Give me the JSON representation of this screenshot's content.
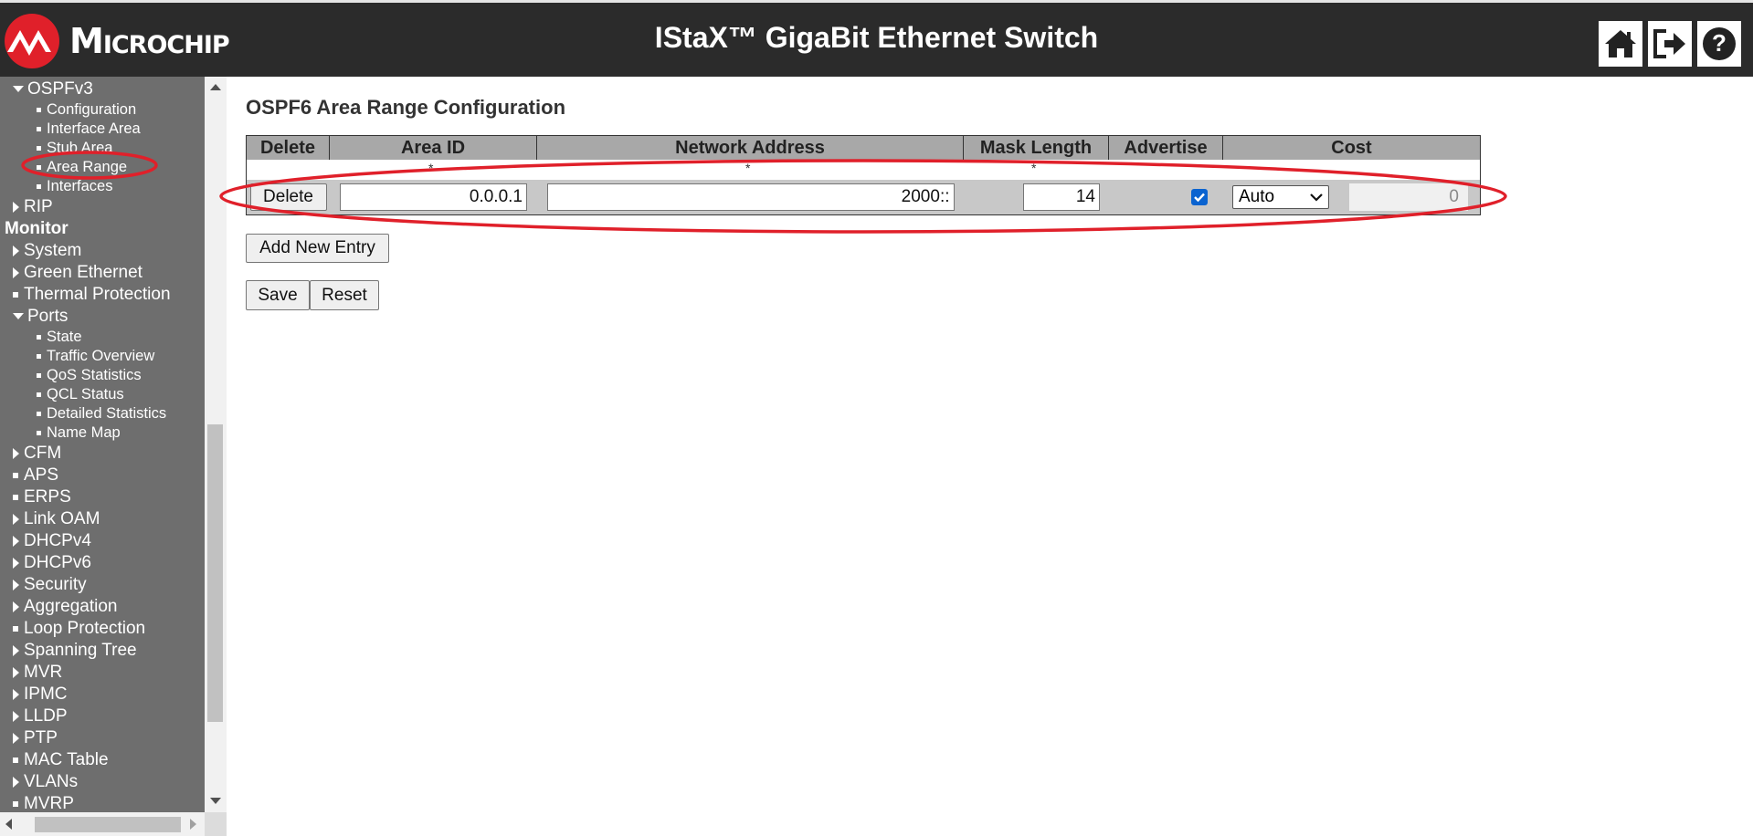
{
  "header": {
    "logo_text": "Microchip",
    "title": "IStaX™ GigaBit Ethernet Switch",
    "buttons": [
      "home-icon",
      "logout-icon",
      "help-icon"
    ]
  },
  "sidebar": {
    "items": [
      {
        "label": "OSPFv3",
        "kind": "expanded",
        "level": 1
      },
      {
        "label": "Configuration",
        "kind": "leaf",
        "level": 2
      },
      {
        "label": "Interface Area",
        "kind": "leaf",
        "level": 2
      },
      {
        "label": "Stub Area",
        "kind": "leaf",
        "level": 2
      },
      {
        "label": "Area Range",
        "kind": "leaf",
        "level": 2,
        "selected": true
      },
      {
        "label": "Interfaces",
        "kind": "leaf",
        "level": 2
      },
      {
        "label": "RIP",
        "kind": "collapsed",
        "level": 1
      },
      {
        "label": "Monitor",
        "kind": "section",
        "level": 0
      },
      {
        "label": "System",
        "kind": "collapsed",
        "level": 1
      },
      {
        "label": "Green Ethernet",
        "kind": "collapsed",
        "level": 1
      },
      {
        "label": "Thermal Protection",
        "kind": "leaf",
        "level": 1
      },
      {
        "label": "Ports",
        "kind": "expanded",
        "level": 1
      },
      {
        "label": "State",
        "kind": "leaf",
        "level": 2
      },
      {
        "label": "Traffic Overview",
        "kind": "leaf",
        "level": 2
      },
      {
        "label": "QoS Statistics",
        "kind": "leaf",
        "level": 2
      },
      {
        "label": "QCL Status",
        "kind": "leaf",
        "level": 2
      },
      {
        "label": "Detailed Statistics",
        "kind": "leaf",
        "level": 2
      },
      {
        "label": "Name Map",
        "kind": "leaf",
        "level": 2
      },
      {
        "label": "CFM",
        "kind": "collapsed",
        "level": 1
      },
      {
        "label": "APS",
        "kind": "leaf",
        "level": 1
      },
      {
        "label": "ERPS",
        "kind": "leaf",
        "level": 1
      },
      {
        "label": "Link OAM",
        "kind": "collapsed",
        "level": 1
      },
      {
        "label": "DHCPv4",
        "kind": "collapsed",
        "level": 1
      },
      {
        "label": "DHCPv6",
        "kind": "collapsed",
        "level": 1
      },
      {
        "label": "Security",
        "kind": "collapsed",
        "level": 1
      },
      {
        "label": "Aggregation",
        "kind": "collapsed",
        "level": 1
      },
      {
        "label": "Loop Protection",
        "kind": "leaf",
        "level": 1
      },
      {
        "label": "Spanning Tree",
        "kind": "collapsed",
        "level": 1
      },
      {
        "label": "MVR",
        "kind": "collapsed",
        "level": 1
      },
      {
        "label": "IPMC",
        "kind": "collapsed",
        "level": 1
      },
      {
        "label": "LLDP",
        "kind": "collapsed",
        "level": 1
      },
      {
        "label": "PTP",
        "kind": "collapsed",
        "level": 1
      },
      {
        "label": "MAC Table",
        "kind": "leaf",
        "level": 1
      },
      {
        "label": "VLANs",
        "kind": "collapsed",
        "level": 1
      },
      {
        "label": "MVRP",
        "kind": "leaf",
        "level": 1
      }
    ]
  },
  "main": {
    "page_title": "OSPF6 Area Range Configuration",
    "table": {
      "columns": [
        "Delete",
        "Area ID",
        "Network Address",
        "Mask Length",
        "Advertise",
        "Cost"
      ],
      "required_marker": "*",
      "rows": [
        {
          "delete_label": "Delete",
          "area_id": "0.0.0.1",
          "network_address": "2000::",
          "mask_length": "14",
          "advertise": true,
          "cost_mode": "Auto",
          "cost_value": "0"
        }
      ]
    },
    "add_entry_label": "Add New Entry",
    "save_label": "Save",
    "reset_label": "Reset"
  },
  "colors": {
    "header_bg": "#2b2b2b",
    "sidebar_bg": "#6e6e6e",
    "table_header_bg": "#a8a8a8",
    "highlight": "#e0202a",
    "checkbox": "#0a63d0"
  }
}
